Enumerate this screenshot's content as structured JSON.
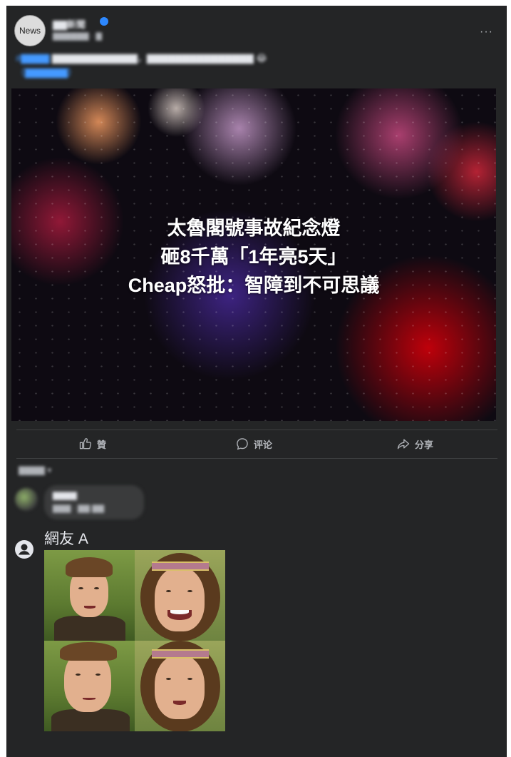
{
  "post": {
    "avatar_text": "News",
    "page_name": "▇▇新聞",
    "time": "▇▇▇▇▇▇ · ▇",
    "more": "···",
    "caption_line1_tag": "#▇▇▇▇",
    "caption_line1": " ▇▇▇▇▇▇▇▇▇▇▇▇，▇▇▇▇▇▇▇▇▇▇▇▇▇▇▇ 😂",
    "caption_line2": "（▇▇▇▇▇▇）"
  },
  "image": {
    "headline": [
      "太魯閣號事故紀念燈",
      "砸8千萬「1年亮5天」",
      "Cheap怒批：智障到不可思議"
    ]
  },
  "actions": {
    "like": "贊",
    "comment": "评论",
    "share": "分享"
  },
  "comments": {
    "sort_label": "▇▇▇▇ ▾",
    "blurred": {
      "name": "▇▇▇▇",
      "meta": "▇▇▇ · ▇▇ ▇▇"
    },
    "user": {
      "name": "網友 A"
    }
  },
  "colors": {
    "card": "#242526",
    "text": "#e4e6eb",
    "muted": "#b0b3b8",
    "link": "#4599ff"
  }
}
